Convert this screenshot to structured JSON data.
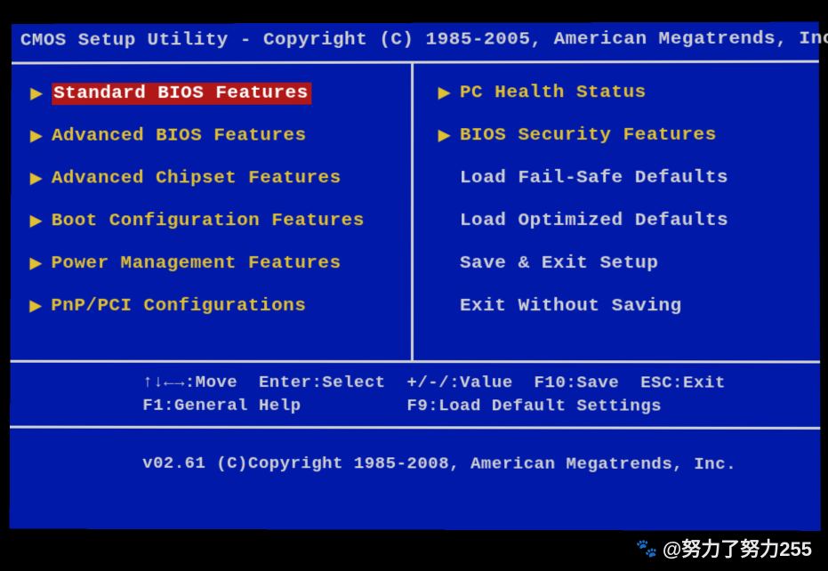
{
  "header": "CMOS Setup Utility - Copyright (C) 1985-2005, American Megatrends, Inc",
  "menu": {
    "left": [
      {
        "label": "Standard BIOS Features",
        "arrow": true,
        "selected": true,
        "plain": false
      },
      {
        "label": "Advanced BIOS Features",
        "arrow": true,
        "selected": false,
        "plain": false
      },
      {
        "label": "Advanced Chipset Features",
        "arrow": true,
        "selected": false,
        "plain": false
      },
      {
        "label": "Boot Configuration Features",
        "arrow": true,
        "selected": false,
        "plain": false
      },
      {
        "label": "Power Management Features",
        "arrow": true,
        "selected": false,
        "plain": false
      },
      {
        "label": "PnP/PCI Configurations",
        "arrow": true,
        "selected": false,
        "plain": false
      }
    ],
    "right": [
      {
        "label": "PC Health Status",
        "arrow": true,
        "selected": false,
        "plain": false
      },
      {
        "label": "BIOS Security Features",
        "arrow": true,
        "selected": false,
        "plain": false
      },
      {
        "label": "Load Fail-Safe Defaults",
        "arrow": false,
        "selected": false,
        "plain": true
      },
      {
        "label": "Load Optimized Defaults",
        "arrow": false,
        "selected": false,
        "plain": true
      },
      {
        "label": "Save & Exit Setup",
        "arrow": false,
        "selected": false,
        "plain": true
      },
      {
        "label": "Exit Without Saving",
        "arrow": false,
        "selected": false,
        "plain": true
      }
    ]
  },
  "help": {
    "line1": "↑↓←→:Move  Enter:Select  +/-/:Value  F10:Save  ESC:Exit",
    "line2": "F1:General Help          F9:Load Default Settings"
  },
  "footer": "v02.61 (C)Copyright 1985-2008, American Megatrends, Inc.",
  "watermark": "@努力了努力255"
}
